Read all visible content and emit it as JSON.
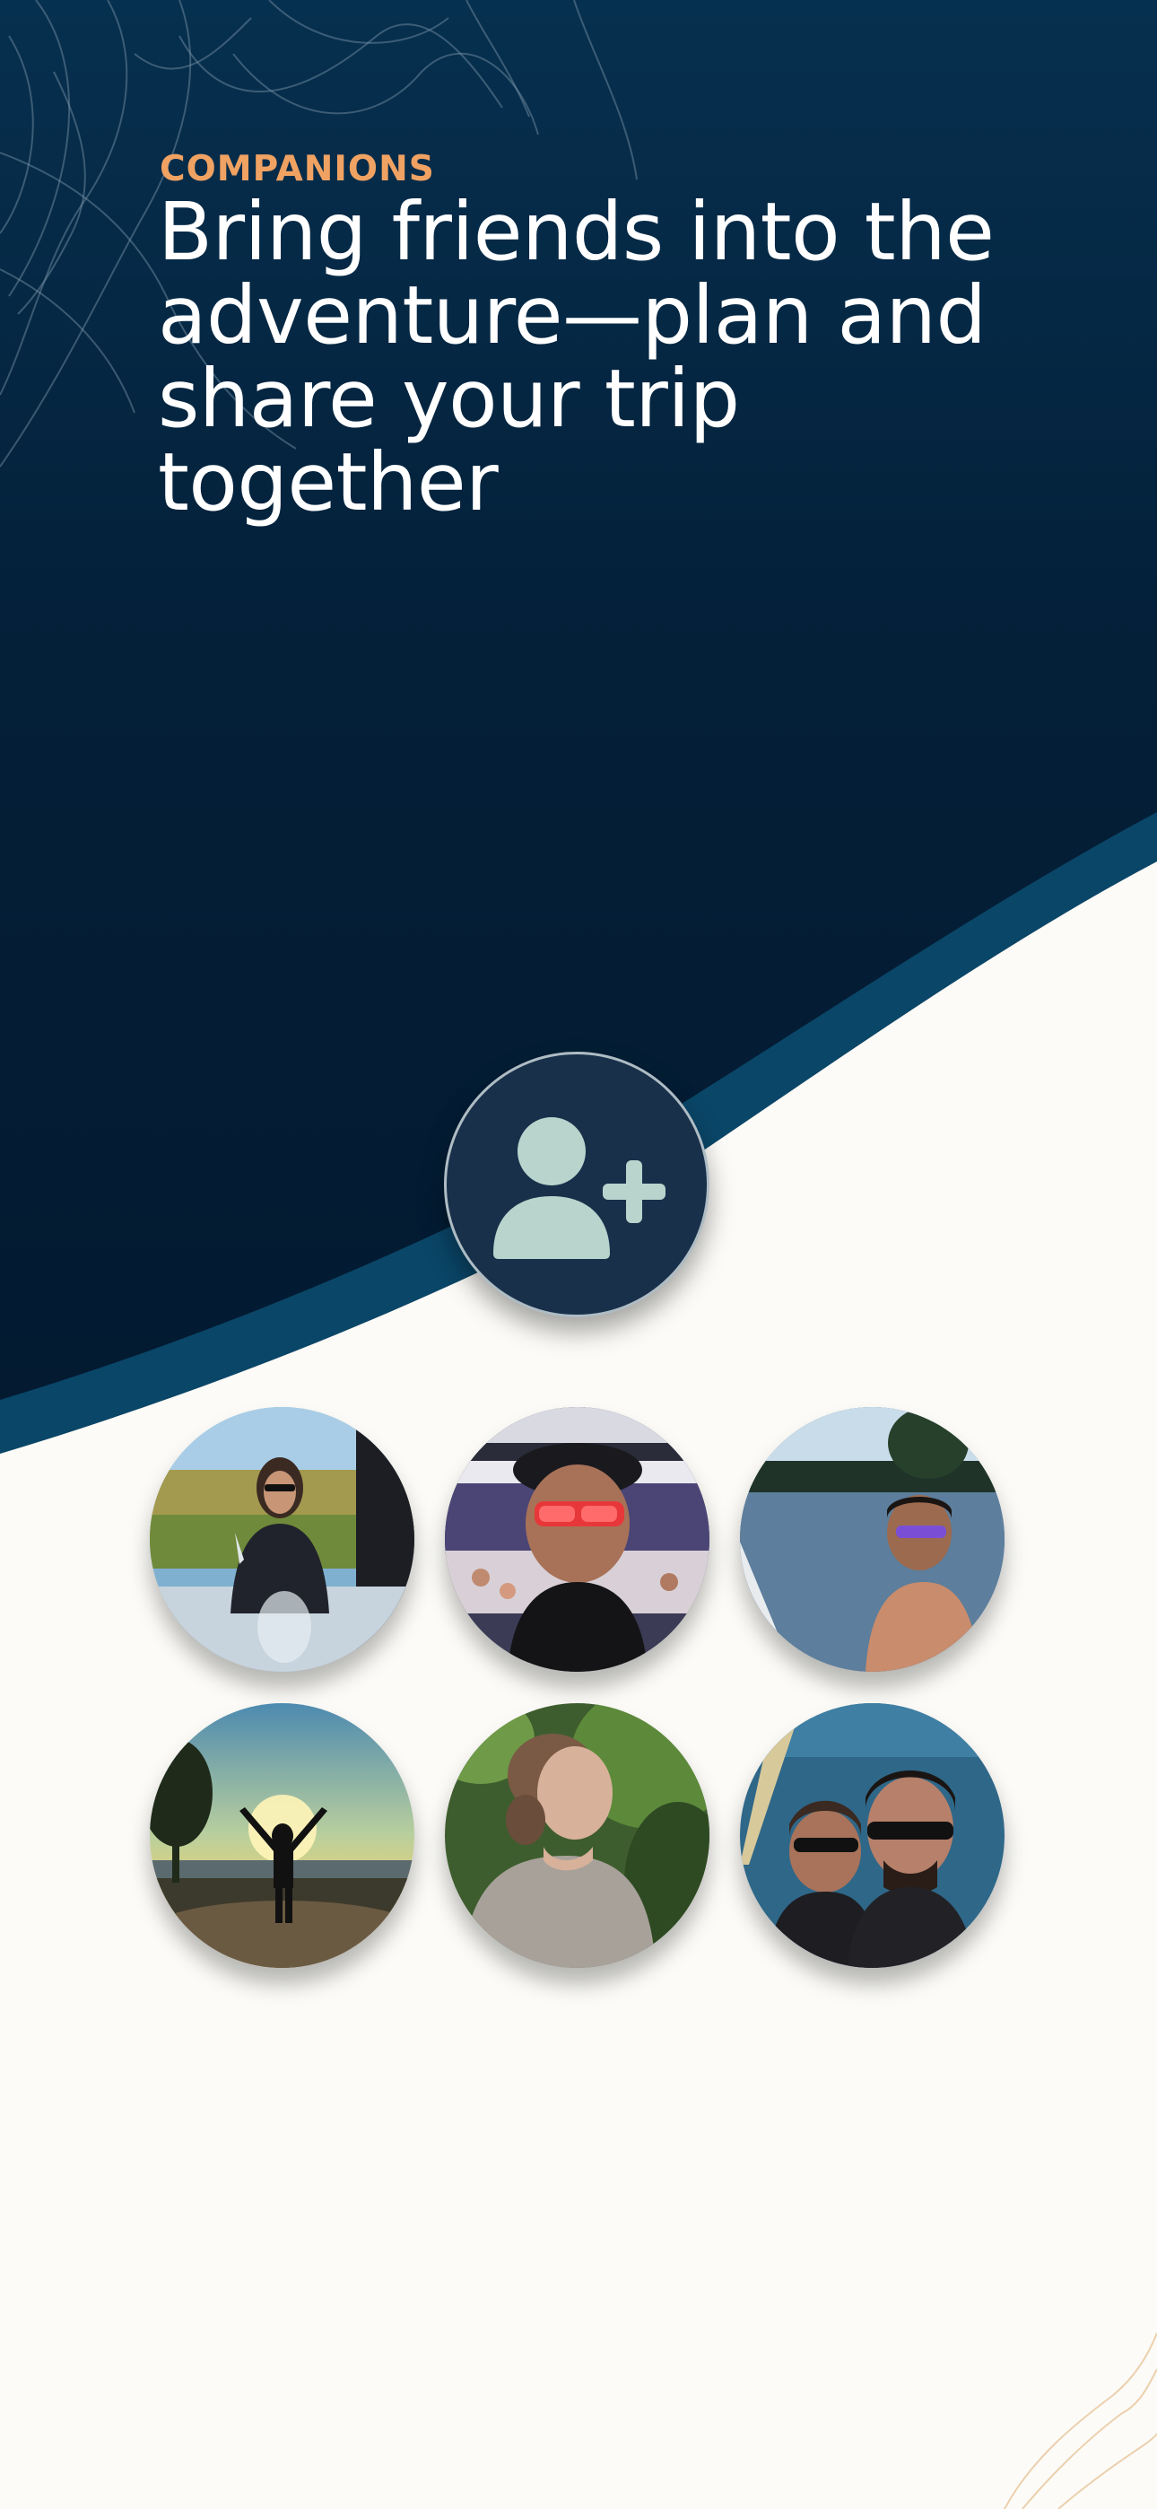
{
  "header": {
    "eyebrow": "COMPANIONS",
    "title": "Bring friends into the adventure—plan and share your trip together"
  },
  "add_companion": {
    "icon": "add-user-icon"
  },
  "companions": [
    {
      "photo": "companion-photo-1"
    },
    {
      "photo": "companion-photo-2"
    },
    {
      "photo": "companion-photo-3"
    },
    {
      "photo": "companion-photo-4"
    },
    {
      "photo": "companion-photo-5"
    },
    {
      "photo": "companion-photo-6"
    }
  ],
  "colors": {
    "navy_dark": "#04203a",
    "navy_mid": "#06304f",
    "wave_band": "#0a4668",
    "cream": "#fcfbf7",
    "accent_orange": "#f0a263",
    "icon_tint": "#b9d4cd",
    "button_bg": "#19304a"
  }
}
